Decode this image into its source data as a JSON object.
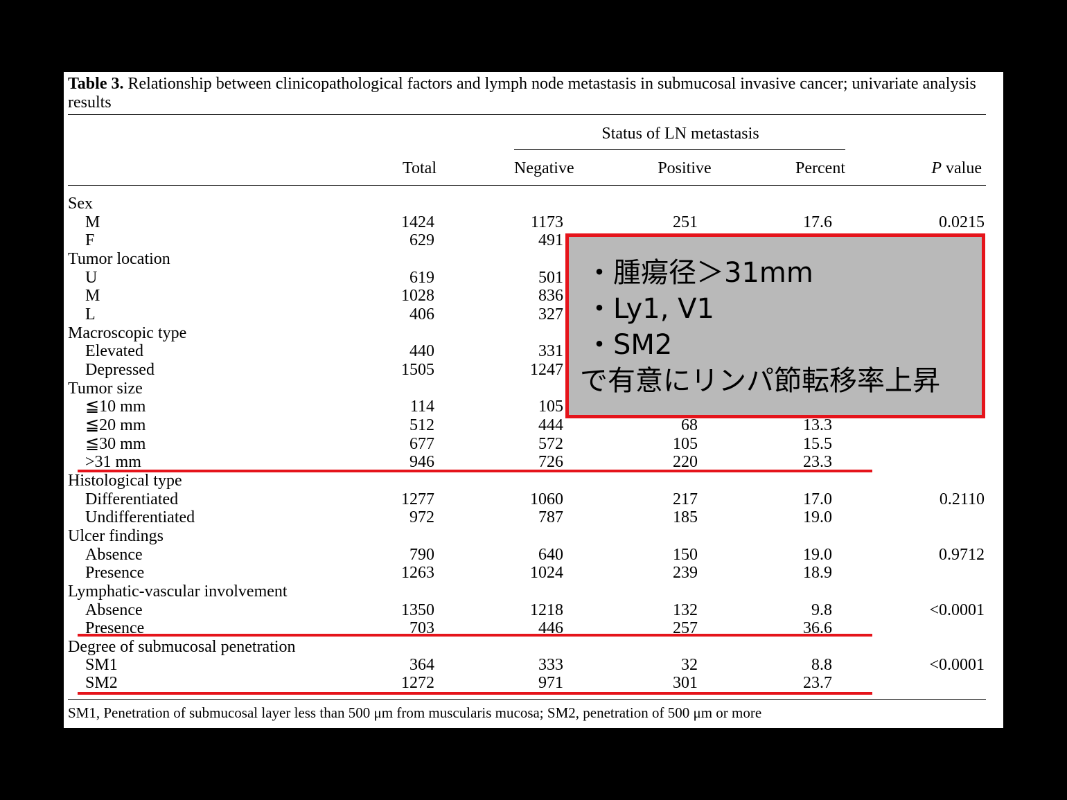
{
  "caption": {
    "label": "Table 3.",
    "text": "Relationship between clinicopathological factors and lymph node metastasis in submucosal invasive cancer; univariate analysis results"
  },
  "headers": {
    "group": "Status of LN metastasis",
    "total": "Total",
    "negative": "Negative",
    "positive": "Positive",
    "percent": "Percent",
    "p_italic": "P",
    "p_rest": " value"
  },
  "rows": [
    {
      "label": "Sex",
      "indent": false
    },
    {
      "label": "M",
      "indent": true,
      "total": "1424",
      "negative": "1173",
      "positive": "251",
      "percent": "17.6",
      "p": "0.0215"
    },
    {
      "label": "F",
      "indent": true,
      "total": "629",
      "negative": "491"
    },
    {
      "label": "Tumor location",
      "indent": false
    },
    {
      "label": "U",
      "indent": true,
      "total": "619",
      "negative": "501"
    },
    {
      "label": "M",
      "indent": true,
      "total": "1028",
      "negative": "836"
    },
    {
      "label": "L",
      "indent": true,
      "total": "406",
      "negative": "327"
    },
    {
      "label": "Macroscopic type",
      "indent": false
    },
    {
      "label": "Elevated",
      "indent": true,
      "total": "440",
      "negative": "331"
    },
    {
      "label": "Depressed",
      "indent": true,
      "total": "1505",
      "negative": "1247"
    },
    {
      "label": "Tumor size",
      "indent": false
    },
    {
      "label": "≦10 mm",
      "indent": true,
      "total": "114",
      "negative": "105"
    },
    {
      "label": "≦20 mm",
      "indent": true,
      "total": "512",
      "negative": "444",
      "positive": "68",
      "percent": "13.3"
    },
    {
      "label": "≦30 mm",
      "indent": true,
      "total": "677",
      "negative": "572",
      "positive": "105",
      "percent": "15.5"
    },
    {
      "label": ">31 mm",
      "indent": true,
      "total": "946",
      "negative": "726",
      "positive": "220",
      "percent": "23.3"
    },
    {
      "label": "Histological type",
      "indent": false
    },
    {
      "label": "Differentiated",
      "indent": true,
      "total": "1277",
      "negative": "1060",
      "positive": "217",
      "percent": "17.0",
      "p": "0.2110"
    },
    {
      "label": "Undifferentiated",
      "indent": true,
      "total": "972",
      "negative": "787",
      "positive": "185",
      "percent": "19.0"
    },
    {
      "label": "Ulcer findings",
      "indent": false
    },
    {
      "label": "Absence",
      "indent": true,
      "total": "790",
      "negative": "640",
      "positive": "150",
      "percent": "19.0",
      "p": "0.9712"
    },
    {
      "label": "Presence",
      "indent": true,
      "total": "1263",
      "negative": "1024",
      "positive": "239",
      "percent": "18.9"
    },
    {
      "label": "Lymphatic-vascular involvement",
      "indent": false
    },
    {
      "label": "Absence",
      "indent": true,
      "total": "1350",
      "negative": "1218",
      "positive": "132",
      "percent": "9.8",
      "p": "<0.0001"
    },
    {
      "label": "Presence",
      "indent": true,
      "total": "703",
      "negative": "446",
      "positive": "257",
      "percent": "36.6"
    },
    {
      "label": "Degree of submucosal penetration",
      "indent": false
    },
    {
      "label": "SM1",
      "indent": true,
      "total": "364",
      "negative": "333",
      "positive": "32",
      "percent": "8.8",
      "p": "<0.0001"
    },
    {
      "label": "SM2",
      "indent": true,
      "total": "1272",
      "negative": "971",
      "positive": "301",
      "percent": "23.7"
    }
  ],
  "footnote": "SM1, Penetration of submucosal layer less than 500 μm from muscularis mucosa; SM2, penetration of 500 μm or more",
  "callout": {
    "lines": [
      "・腫瘍径＞31mm",
      "・Ly1, V1",
      "・SM2",
      "で有意にリンパ節転移率上昇"
    ],
    "background": "#b9b9b9",
    "border_color": "#e5141b"
  },
  "colors": {
    "highlight_underline": "#e5141b",
    "slide_background": "#000000",
    "paper": "#ffffff"
  }
}
